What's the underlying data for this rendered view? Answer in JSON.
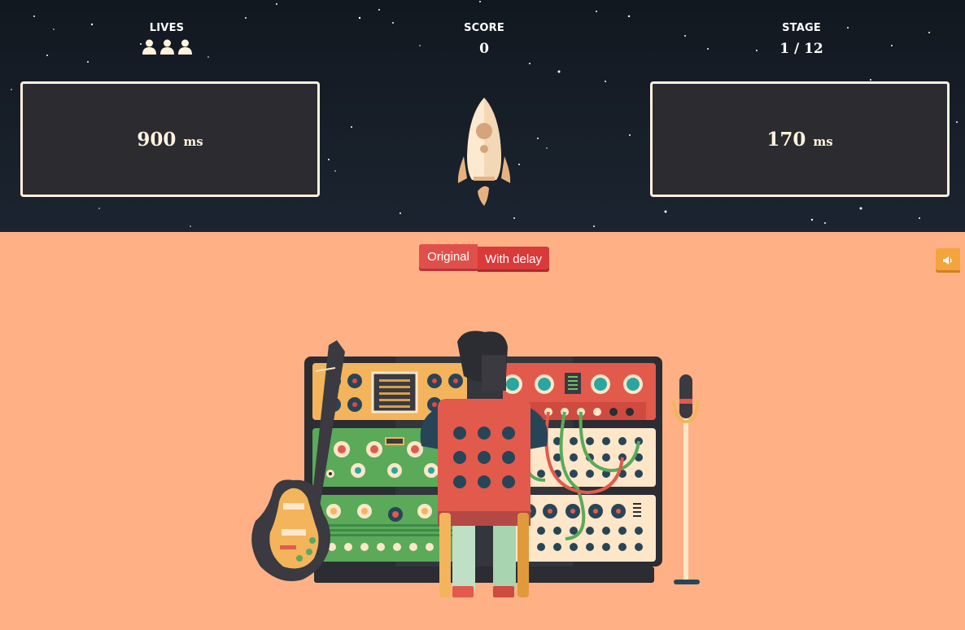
{
  "hud": {
    "lives": {
      "label": "LIVES",
      "count": 3,
      "icon": "person-icon"
    },
    "score": {
      "label": "SCORE",
      "value": "0"
    },
    "stage": {
      "label": "STAGE",
      "value": "1 / 12"
    }
  },
  "panels": {
    "left": {
      "value": "900",
      "unit": "ms"
    },
    "right": {
      "value": "170",
      "unit": "ms"
    }
  },
  "toggle": {
    "original_label": "Original",
    "delay_label": "With delay",
    "selected": "Original"
  },
  "sound": {
    "icon": "speaker-icon"
  },
  "colors": {
    "sky": "#141b25",
    "ground": "#ffb185",
    "panel_border": "#fff3dd",
    "accent_red": "#d93a3a",
    "sound_button": "#f5a43d"
  }
}
